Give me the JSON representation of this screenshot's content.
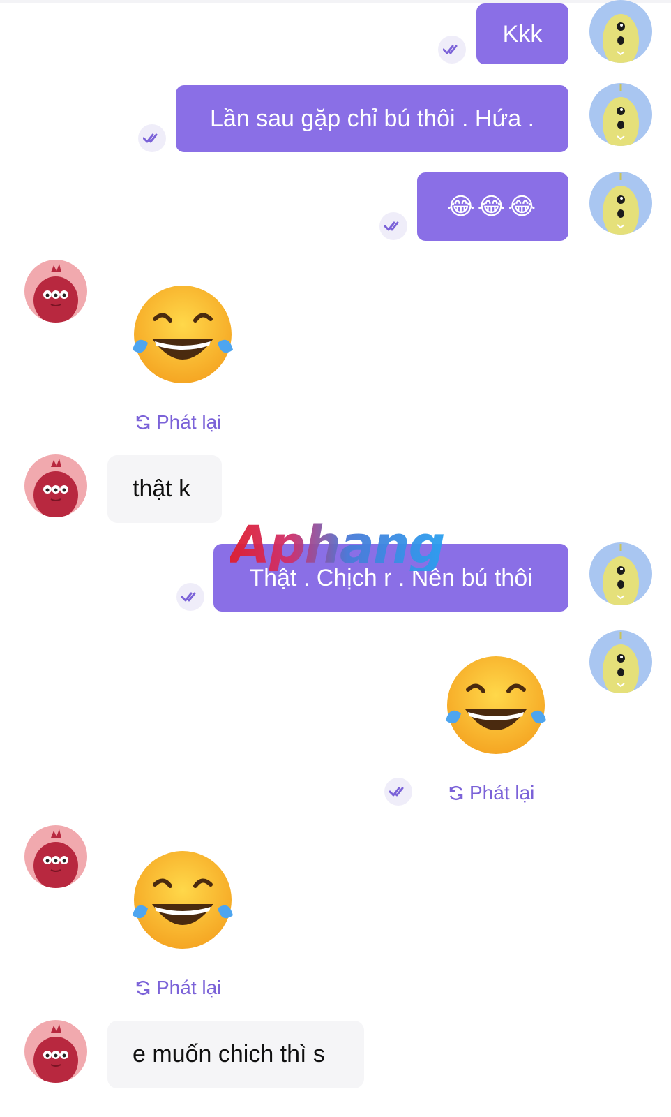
{
  "chat": {
    "messages": [
      {
        "id": "m1",
        "side": "out",
        "type": "text",
        "text": "Kkk"
      },
      {
        "id": "m2",
        "side": "out",
        "type": "text",
        "text": "Lần sau gặp chỉ bú thôi . Hứa ."
      },
      {
        "id": "m3",
        "side": "out",
        "type": "emoji-text",
        "text": "😂😂😂"
      },
      {
        "id": "m4",
        "side": "in",
        "type": "sticker",
        "emoji": "😂",
        "replay_label": "Phát lại"
      },
      {
        "id": "m5",
        "side": "in",
        "type": "text",
        "text": "thật k"
      },
      {
        "id": "m6",
        "side": "out",
        "type": "text",
        "text": "Thật . Chịch r . Nên bú thôi"
      },
      {
        "id": "m7",
        "side": "out",
        "type": "sticker",
        "emoji": "😂",
        "replay_label": "Phát lại"
      },
      {
        "id": "m8",
        "side": "in",
        "type": "sticker",
        "emoji": "😂",
        "replay_label": "Phát lại"
      },
      {
        "id": "m9",
        "side": "in",
        "type": "text",
        "text": "e muốn chich thì s"
      }
    ]
  },
  "watermark": {
    "text": "Aphang"
  },
  "icons": {
    "seen": "double-check-icon",
    "replay": "replay-icon",
    "my_avatar": "yellow-monster-avatar",
    "their_avatar": "red-monster-avatar"
  },
  "colors": {
    "outgoing_bubble": "#8a6fe6",
    "incoming_bubble": "#f5f5f7",
    "accent": "#7b62d8",
    "my_avatar_bg": "#a9c6f1",
    "their_avatar_bg": "#f1a9ae"
  }
}
